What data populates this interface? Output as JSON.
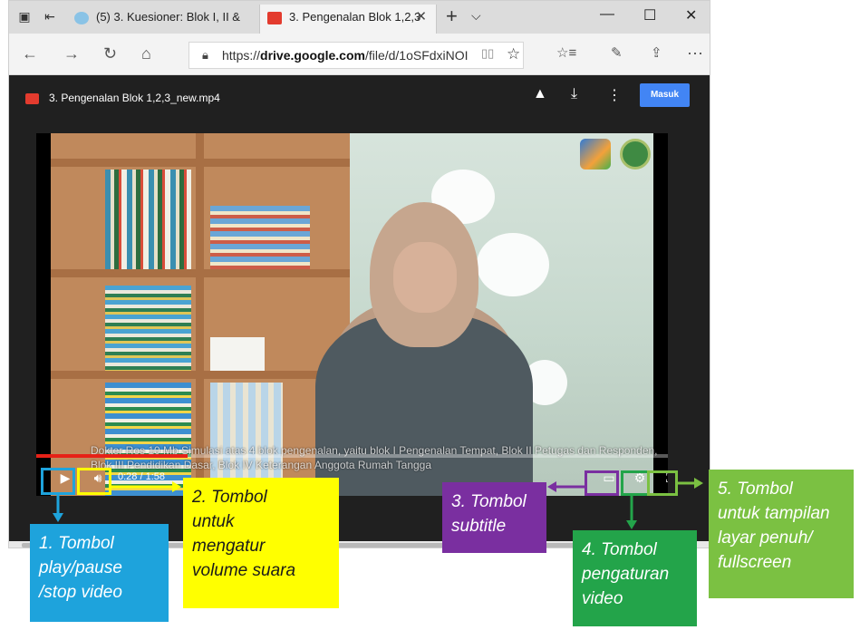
{
  "browser": {
    "tabs": [
      {
        "title": "(5) 3. Kuesioner: Blok I, II &",
        "active": false
      },
      {
        "title": "3. Pengenalan Blok 1,2,3",
        "active": true
      }
    ],
    "address": {
      "prefix": "https://",
      "domain": "drive.google.com",
      "path": "/file/d/1oSFdxiNOI"
    }
  },
  "drive": {
    "file_name": "3. Pengenalan Blok 1,2,3_new.mp4",
    "sign_in_label": "Masuk"
  },
  "video": {
    "subtitle": "Dokter Ros 10 Mb Simulasi atas 4 blok pengenalan, yaitu blok I Pengenalan Tempat, Blok II Petugas dan Responden, Blok III Pendidikan Dasar, Blok IV Keterangan Anggota Rumah Tangga",
    "time": "0:28 / 1:58",
    "progress": 0.24
  },
  "annotations": [
    {
      "id": "play",
      "text": "1. Tombol\nplay/pause\n/stop video",
      "color": "#1ea3dc",
      "text_color": "#ffffff"
    },
    {
      "id": "volume",
      "text": "2. Tombol\nuntuk\nmengatur\nvolume suara",
      "color": "#ffff00",
      "text_color": "#1a1a1a"
    },
    {
      "id": "subtitle",
      "text": "3. Tombol\nsubtitle",
      "color": "#7a2fa0",
      "text_color": "#ffffff"
    },
    {
      "id": "settings",
      "text": "4. Tombol\npengaturan\nvideo",
      "color": "#23a44a",
      "text_color": "#ffffff"
    },
    {
      "id": "fullscreen",
      "text": "5. Tombol\nuntuk tampilan\nlayar penuh/\nfullscreen",
      "color": "#7bc142",
      "text_color": "#ffffff"
    }
  ]
}
